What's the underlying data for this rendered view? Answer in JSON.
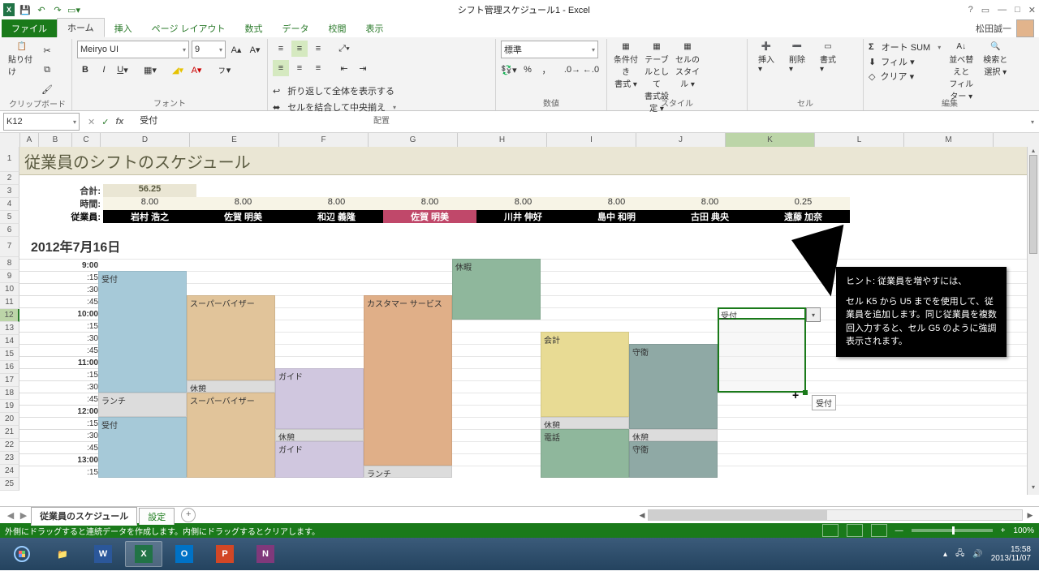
{
  "titlebar": {
    "title": "シフト管理スケジュール1 - Excel"
  },
  "account": {
    "name": "松田誠一"
  },
  "tabs": {
    "file": "ファイル",
    "home": "ホーム",
    "insert": "挿入",
    "layout": "ページ レイアウト",
    "formulas": "数式",
    "data": "データ",
    "review": "校閲",
    "view": "表示"
  },
  "ribbon": {
    "clipboard": {
      "title": "クリップボード",
      "paste": "貼り付け"
    },
    "font": {
      "title": "フォント",
      "name": "Meiryo UI",
      "size": "9"
    },
    "align": {
      "title": "配置",
      "wrap": "折り返して全体を表示する",
      "merge": "セルを結合して中央揃え"
    },
    "number": {
      "title": "数値",
      "format": "標準"
    },
    "styles": {
      "title": "スタイル",
      "cond": "条件付き\n書式 ▾",
      "table": "テーブルとして\n書式設定 ▾",
      "cell": "セルの\nスタイル ▾"
    },
    "cells": {
      "title": "セル",
      "insert": "挿入\n▾",
      "delete": "削除\n▾",
      "format": "書式\n▾"
    },
    "editing": {
      "title": "編集",
      "sum": "オート SUM",
      "fill": "フィル ▾",
      "clear": "クリア ▾",
      "sort": "並べ替えと\nフィルター ▾",
      "find": "検索と\n選択 ▾"
    }
  },
  "namebox": "K12",
  "formula": "受付",
  "columns": [
    "A",
    "B",
    "C",
    "D",
    "E",
    "F",
    "G",
    "H",
    "I",
    "J",
    "K",
    "L",
    "M"
  ],
  "title_cell": "従業員のシフトのスケジュール",
  "labels": {
    "total": "合計:",
    "hours": "時間:",
    "employees": "従業員:"
  },
  "total": "56.25",
  "hours": [
    "8.00",
    "8.00",
    "8.00",
    "8.00",
    "8.00",
    "8.00",
    "8.00",
    "0.25"
  ],
  "employees": [
    "岩村 浩之",
    "佐賀 明美",
    "和辺 義隆",
    "佐賀 明美",
    "川井 伸好",
    "島中 和明",
    "古田 典央",
    "遠藤 加奈"
  ],
  "date": "2012年7月16日",
  "times": [
    "9:00",
    ":15",
    ":30",
    ":45",
    "10:00",
    ":15",
    ":30",
    ":45",
    "11:00",
    ":15",
    ":30",
    ":45",
    "12:00",
    ":15",
    ":30",
    ":45",
    "13:00",
    ":15"
  ],
  "blocks": {
    "d_recept": "受付",
    "d_lunch": "ランチ",
    "d_recept2": "受付",
    "e_super": "スーパーバイザー",
    "e_break": "休憩",
    "e_super2": "スーパーバイザー",
    "f_guide": "ガイド",
    "f_break": "休憩",
    "f_guide2": "ガイド",
    "g_cs": "カスタマー サービス",
    "g_lunch": "ランチ",
    "h_vac": "休暇",
    "i_acct": "会計",
    "i_break": "休憩",
    "i_phone": "電話",
    "j_guard": "守衛",
    "j_break": "休憩",
    "j_guard2": "守衛",
    "k_recept": "受付"
  },
  "fill_tooltip": "受付",
  "hint": {
    "l1": "ヒント: 従業員を増やすには、",
    "l2": "セル K5 から U5 までを使用して、従業員を追加します。同じ従業員を複数回入力すると、セル G5 のように強調表示されます。"
  },
  "sheet_tabs": {
    "t1": "従業員のスケジュール",
    "t2": "設定"
  },
  "statusbar": {
    "msg": "外側にドラッグすると連続データを作成します。内側にドラッグするとクリアします。",
    "zoom": "100%"
  },
  "clock": {
    "time": "15:58",
    "date": "2013/11/07"
  }
}
